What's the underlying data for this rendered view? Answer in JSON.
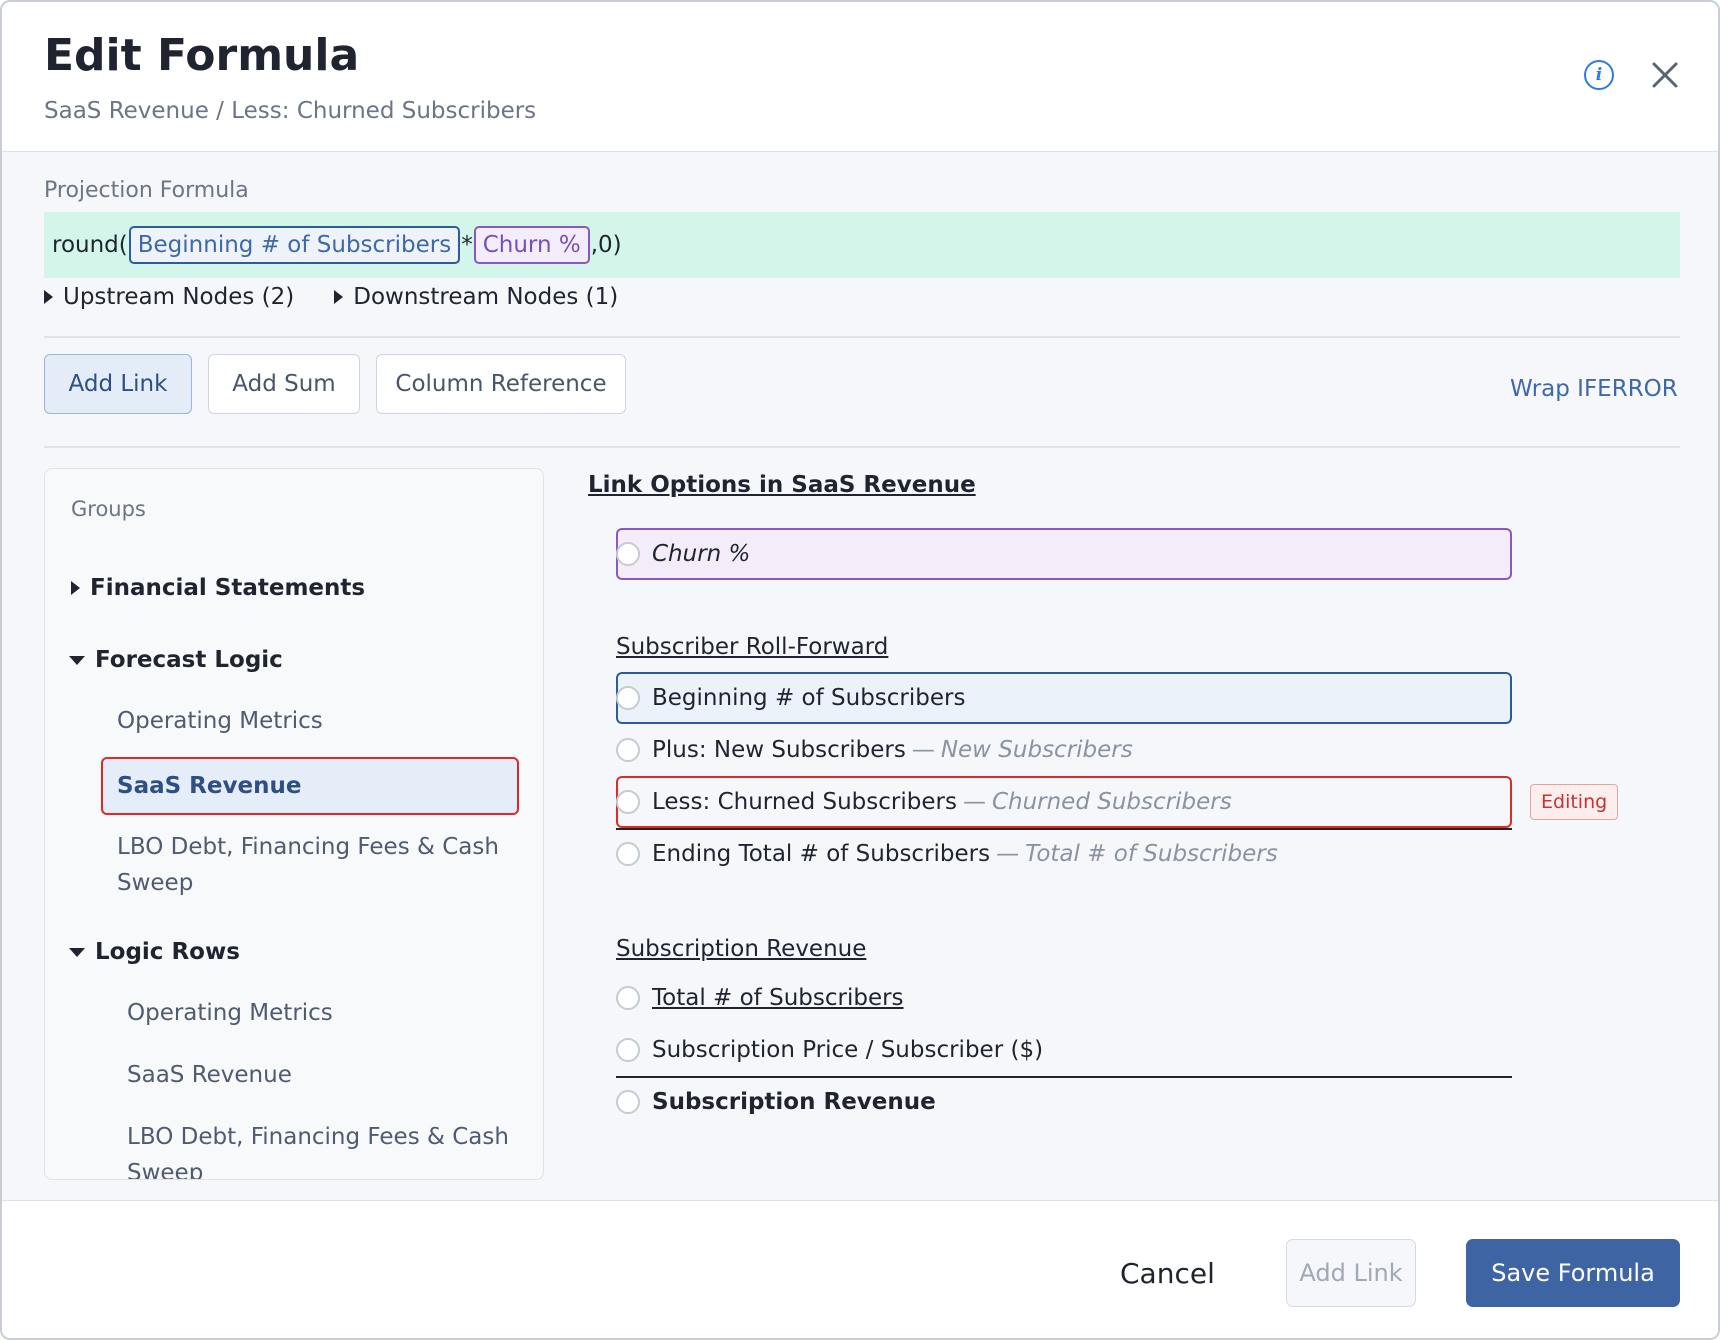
{
  "header": {
    "title": "Edit Formula",
    "breadcrumb": "SaaS Revenue / Less: Churned Subscribers"
  },
  "formula": {
    "label": "Projection Formula",
    "prefix": "round(",
    "token1": "Beginning # of Subscribers",
    "operator": "*",
    "token2": "Churn %",
    "suffix": ",0)",
    "upstream": "Upstream Nodes (2)",
    "downstream": "Downstream Nodes (1)"
  },
  "toolbar": {
    "add_link": "Add Link",
    "add_sum": "Add Sum",
    "column_reference": "Column Reference",
    "wrap_iferror": "Wrap IFERROR"
  },
  "groups": {
    "label": "Groups",
    "financial_statements": "Financial Statements",
    "forecast_logic": "Forecast Logic",
    "forecast_items": [
      "Operating Metrics",
      "SaaS Revenue",
      "LBO Debt, Financing Fees & Cash Sweep"
    ],
    "logic_rows": "Logic Rows",
    "logic_items": [
      "Operating Metrics",
      "SaaS Revenue",
      "LBO Debt, Financing Fees & Cash Sweep"
    ]
  },
  "link_options": {
    "title": "Link Options in SaaS Revenue",
    "churn": "Churn %",
    "roll_forward_heading": "Subscriber Roll-Forward",
    "beginning": "Beginning # of Subscribers",
    "plus_new": "Plus: New Subscribers",
    "plus_new_sub": "New Subscribers",
    "less_churned": "Less: Churned Subscribers",
    "less_churned_sub": "Churned Subscribers",
    "ending": "Ending Total # of Subscribers",
    "ending_sub": "Total # of Subscribers",
    "dash": "—",
    "editing_badge": "Editing",
    "subscription_heading": "Subscription Revenue",
    "total_subs": "Total # of Subscribers",
    "price": "Subscription Price / Subscriber ($)",
    "subscription_revenue": "Subscription Revenue"
  },
  "footer": {
    "cancel": "Cancel",
    "add_link": "Add Link",
    "save": "Save Formula"
  },
  "colors": {
    "accent": "#3e64a3",
    "formula_bg": "#d4f5e9",
    "highlight_red": "#e02a2a",
    "token_purple": "#8a58c2",
    "token_blue": "#2c5d99"
  }
}
